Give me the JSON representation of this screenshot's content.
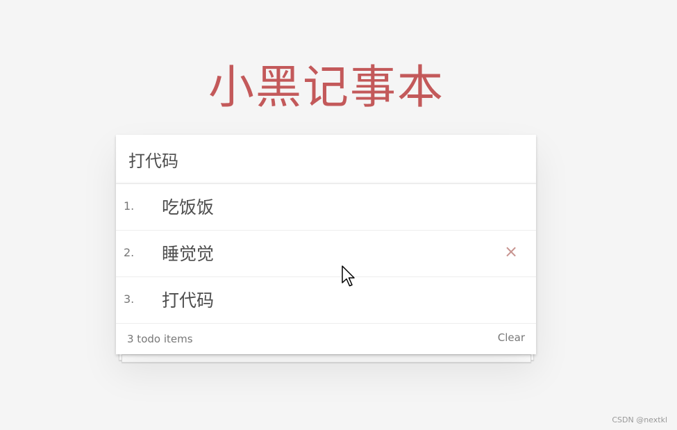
{
  "header": {
    "title": "小黑记事本"
  },
  "input": {
    "value": "打代码",
    "placeholder": ""
  },
  "todos": [
    {
      "index": "1.",
      "text": "吃饭饭"
    },
    {
      "index": "2.",
      "text": "睡觉觉"
    },
    {
      "index": "3.",
      "text": "打代码"
    }
  ],
  "delete_icon": "×",
  "footer": {
    "count_text": "3 todo items",
    "clear_label": "Clear"
  },
  "watermark": "CSDN @nextkl",
  "colors": {
    "title": "#c3595a",
    "delete": "#c7938f",
    "background": "#f5f5f5"
  }
}
